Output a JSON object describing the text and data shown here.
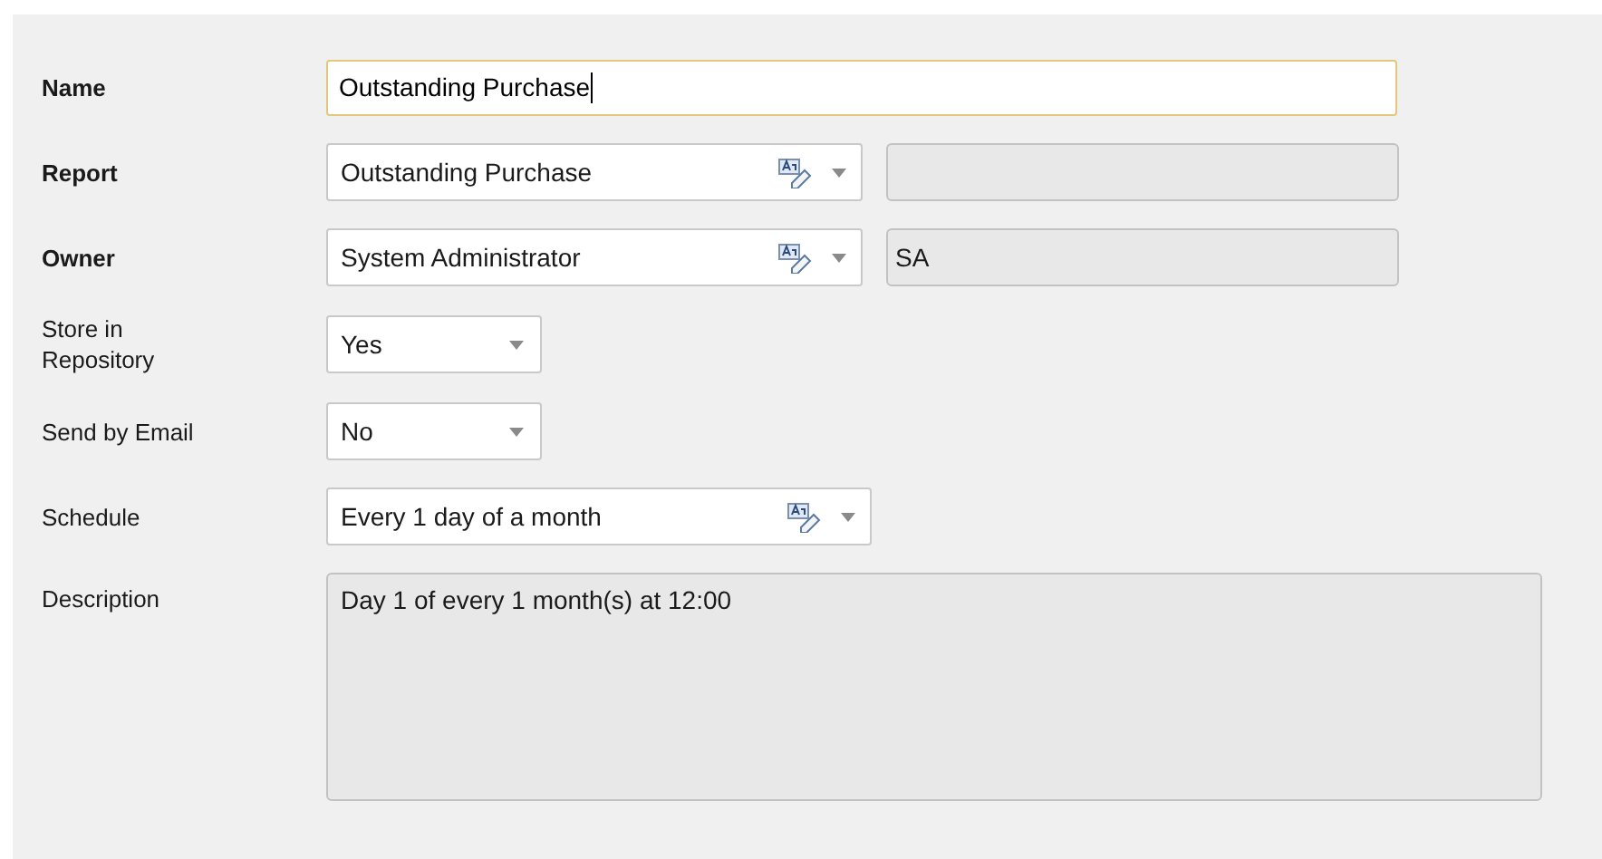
{
  "fields": [
    {
      "label": "Name",
      "required": true,
      "kind": "text",
      "value": "Outstanding Purchase",
      "focused": true
    },
    {
      "label": "Report",
      "required": true,
      "kind": "lookup_with_code",
      "value": "Outstanding Purchase"
    },
    {
      "label": "Owner",
      "required": true,
      "kind": "lookup_with_code",
      "value": "System Administrator",
      "code": "SA"
    },
    {
      "label": "Store in Repository",
      "required": false,
      "kind": "dropdown",
      "value": "Yes"
    },
    {
      "label": "Send by Email",
      "required": false,
      "kind": "dropdown",
      "value": "No"
    },
    {
      "label": "Schedule",
      "required": false,
      "kind": "lookup",
      "value": "Every 1 day of a month"
    },
    {
      "label": "Description",
      "required": false,
      "kind": "textarea",
      "value": "Day 1 of every 1 month(s) at 12:00"
    }
  ]
}
